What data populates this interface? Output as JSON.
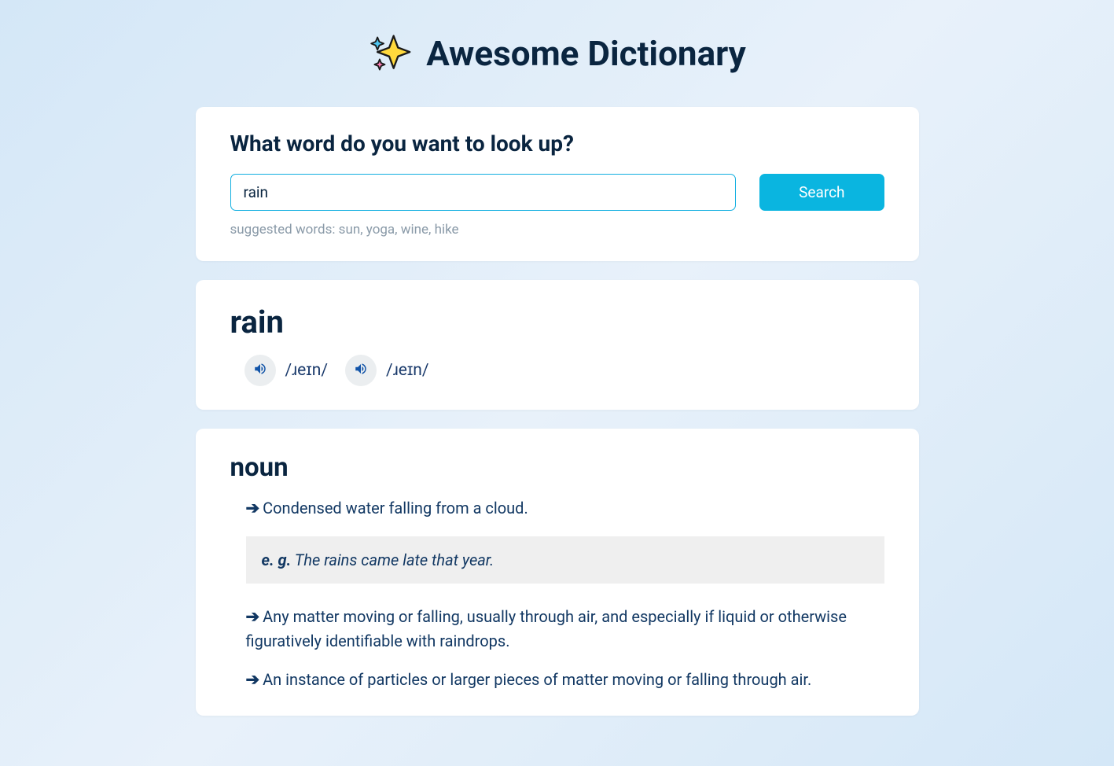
{
  "header": {
    "title": "Awesome Dictionary"
  },
  "search": {
    "prompt": "What word do you want to look up?",
    "value": "rain",
    "button_label": "Search",
    "suggestions": "suggested words: sun, yoga, wine, hike"
  },
  "word": {
    "headword": "rain",
    "phonetics": [
      {
        "text": "/ɹeɪn/"
      },
      {
        "text": "/ɹeɪn/"
      }
    ]
  },
  "meanings": {
    "part_of_speech": "noun",
    "definitions": [
      "Condensed water falling from a cloud.",
      "Any matter moving or falling, usually through air, and especially if liquid or otherwise figuratively identifiable with raindrops.",
      "An instance of particles or larger pieces of matter moving or falling through air."
    ],
    "example_label": "e. g.",
    "example_text_prefix": " ",
    "example": "The rains came late that year."
  }
}
